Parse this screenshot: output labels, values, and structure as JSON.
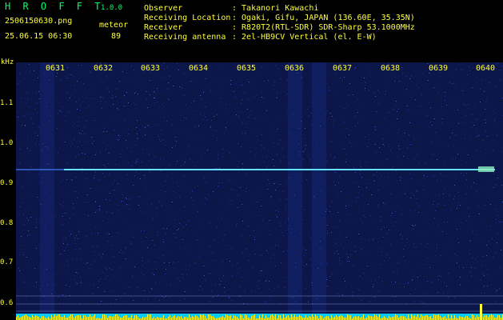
{
  "app": {
    "title": "H R O F F T",
    "version": "1.0.0"
  },
  "file": {
    "name": "2506150630.png",
    "datetime": "25.06.15 06:30"
  },
  "detection": {
    "label": "meteor",
    "count": "89"
  },
  "info": [
    {
      "label": "Observer",
      "value": ": Takanori Kawachi"
    },
    {
      "label": "Receiving Location",
      "value": ": Ogaki, Gifu, JAPAN (136.60E, 35.35N)"
    },
    {
      "label": "Receiver",
      "value": ": R820T2(RTL-SDR) SDR-Sharp 53.1000MHz"
    },
    {
      "label": "Receiving antenna",
      "value": ": 2el-HB9CV Vertical (el. E-W)"
    }
  ],
  "axis": {
    "unit": "kHz",
    "freq_ticks": [
      "1.1",
      "1.0",
      "0.9",
      "0.8",
      "0.7",
      "0.6"
    ],
    "time_ticks": [
      "0631",
      "0632",
      "0633",
      "0634",
      "0635",
      "0636",
      "0637",
      "0638",
      "0639",
      "0640"
    ]
  },
  "colors": {
    "background": "#0c1648",
    "carrier": "#66e0ff",
    "text_yellow": "#ffff33",
    "title_green": "#00ff66"
  }
}
